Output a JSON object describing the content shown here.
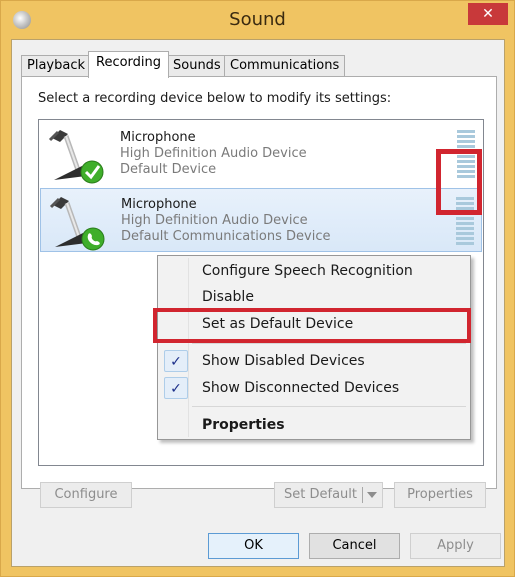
{
  "window": {
    "title": "Sound",
    "close_label": "✕"
  },
  "tabs": [
    {
      "label": "Playback",
      "active": false
    },
    {
      "label": "Recording",
      "active": true
    },
    {
      "label": "Sounds",
      "active": false
    },
    {
      "label": "Communications",
      "active": false
    }
  ],
  "panel": {
    "instruction": "Select a recording device below to modify its settings:"
  },
  "devices": [
    {
      "name": "Microphone",
      "driver": "High Definition Audio Device",
      "status": "Default Device",
      "badge": "check-badge",
      "selected": false
    },
    {
      "name": "Microphone",
      "driver": "High Definition Audio Device",
      "status": "Default Communications Device",
      "badge": "phone-badge",
      "selected": true
    }
  ],
  "context_menu": {
    "items": [
      {
        "label": "Configure Speech Recognition",
        "checked": false,
        "bold": false
      },
      {
        "label": "Disable",
        "checked": false,
        "bold": false
      },
      {
        "label": "Set as Default Device",
        "checked": false,
        "bold": false
      },
      {
        "label": "Show Disabled Devices",
        "checked": true,
        "bold": false
      },
      {
        "label": "Show Disconnected Devices",
        "checked": true,
        "bold": false
      },
      {
        "label": "Properties",
        "checked": false,
        "bold": true
      }
    ],
    "check_glyph": "✓"
  },
  "panel_buttons": {
    "configure": "Configure",
    "set_default": "Set Default",
    "properties": "Properties"
  },
  "dialog_buttons": {
    "ok": "OK",
    "cancel": "Cancel",
    "apply": "Apply"
  },
  "colors": {
    "titlebar": "#f0c462",
    "close": "#c8393a",
    "highlight": "#d1252f",
    "selection": "#d9e8f8",
    "meter": "#a9c9dc"
  }
}
